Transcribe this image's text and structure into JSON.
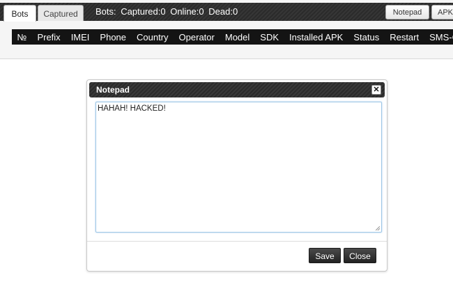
{
  "tabs": [
    {
      "label": "Bots",
      "active": true
    },
    {
      "label": "Captured",
      "active": false
    }
  ],
  "stats": {
    "prefix": "Bots:",
    "captured": "Captured:0",
    "online": "Online:0",
    "dead": "Dead:0"
  },
  "toolbar": {
    "notepad_label": "Notepad",
    "apk_label": "APK"
  },
  "table": {
    "columns": [
      "№",
      "Prefix",
      "IMEI",
      "Phone",
      "Country",
      "Operator",
      "Model",
      "SDK",
      "Installed APK",
      "Status",
      "Restart",
      "SMS-Client"
    ]
  },
  "dialog": {
    "title": "Notepad",
    "close_icon": "close-icon",
    "text": "HAHAH! HACKED!",
    "save_label": "Save",
    "close_label": "Close"
  },
  "colors": {
    "bar_dark": "#2e2e2e",
    "header_black": "#141414",
    "textarea_border": "#9ec7e6"
  }
}
